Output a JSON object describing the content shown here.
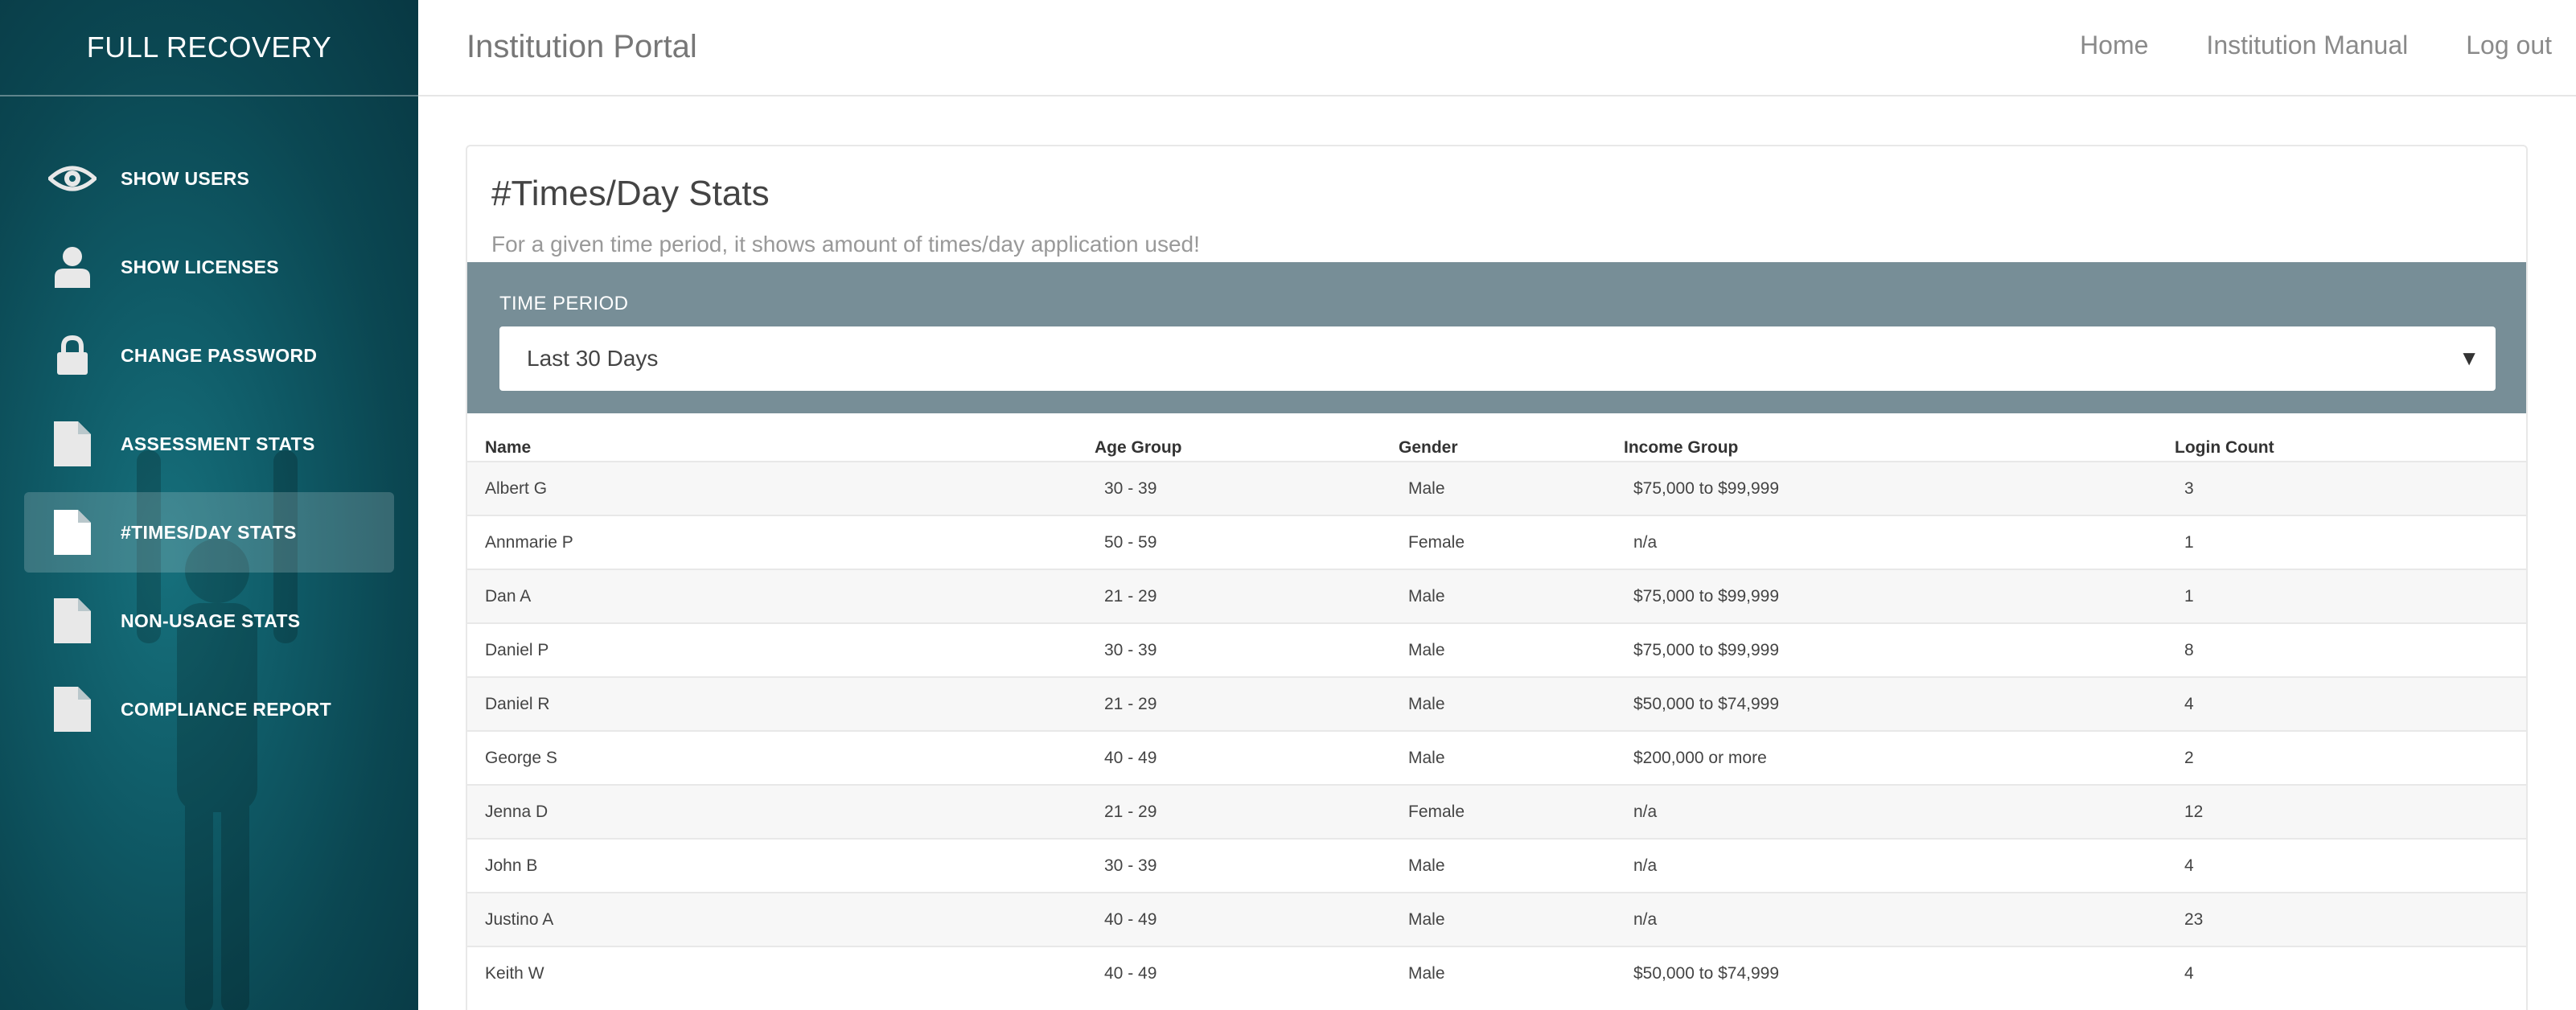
{
  "brand": "FULL RECOVERY",
  "sidebar": {
    "items": [
      {
        "label": "SHOW USERS",
        "icon": "eye-icon",
        "active": false
      },
      {
        "label": "SHOW LICENSES",
        "icon": "user-icon",
        "active": false
      },
      {
        "label": "CHANGE PASSWORD",
        "icon": "lock-icon",
        "active": false
      },
      {
        "label": "ASSESSMENT STATS",
        "icon": "document-icon",
        "active": false
      },
      {
        "label": "#TIMES/DAY STATS",
        "icon": "document-icon",
        "active": true
      },
      {
        "label": "NON-USAGE STATS",
        "icon": "document-icon",
        "active": false
      },
      {
        "label": "COMPLIANCE REPORT",
        "icon": "document-icon",
        "active": false
      }
    ]
  },
  "header": {
    "title": "Institution Portal",
    "nav": [
      "Home",
      "Institution Manual",
      "Log out"
    ]
  },
  "main": {
    "title": "#Times/Day Stats",
    "subtitle": "For a given time period, it shows amount of times/day application used!",
    "filter": {
      "label": "TIME PERIOD",
      "selected": "Last 30 Days"
    },
    "table": {
      "columns": [
        "Name",
        "Age Group",
        "Gender",
        "Income Group",
        "Login Count"
      ],
      "rows": [
        [
          "Albert G",
          "30 - 39",
          "Male",
          "$75,000 to $99,999",
          "3"
        ],
        [
          "Annmarie P",
          "50 - 59",
          "Female",
          "n/a",
          "1"
        ],
        [
          "Dan A",
          "21 - 29",
          "Male",
          "$75,000 to $99,999",
          "1"
        ],
        [
          "Daniel P",
          "30 - 39",
          "Male",
          "$75,000 to $99,999",
          "8"
        ],
        [
          "Daniel R",
          "21 - 29",
          "Male",
          "$50,000 to $74,999",
          "4"
        ],
        [
          "George S",
          "40 - 49",
          "Male",
          "$200,000 or more",
          "2"
        ],
        [
          "Jenna D",
          "21 - 29",
          "Female",
          "n/a",
          "12"
        ],
        [
          "John B",
          "30 - 39",
          "Male",
          "n/a",
          "4"
        ],
        [
          "Justino A",
          "40 - 49",
          "Male",
          "n/a",
          "23"
        ],
        [
          "Keith W",
          "40 - 49",
          "Male",
          "$50,000 to $74,999",
          "4"
        ]
      ]
    }
  },
  "colors": {
    "sidebar_bg": "#0f5a66",
    "filter_bar": "#778e97",
    "active_item_bg": "rgba(255,255,255,0.18)"
  }
}
